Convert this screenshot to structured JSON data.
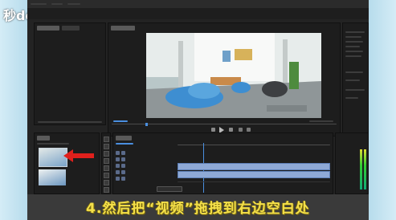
{
  "watermark": {
    "text": "秒dong视频"
  },
  "caption": {
    "text": "4.然后把“视频”拖拽到右边空白处"
  },
  "colors": {
    "caption_text": "#f4e04a",
    "arrow": "#e0201c",
    "timeline_clip": "#8ea9d6",
    "playhead": "#4a8fe0",
    "background": "#c9e6f2"
  },
  "icons": {
    "play": "play-icon",
    "arrow": "red-arrow-icon",
    "tools": "tool-icon"
  }
}
